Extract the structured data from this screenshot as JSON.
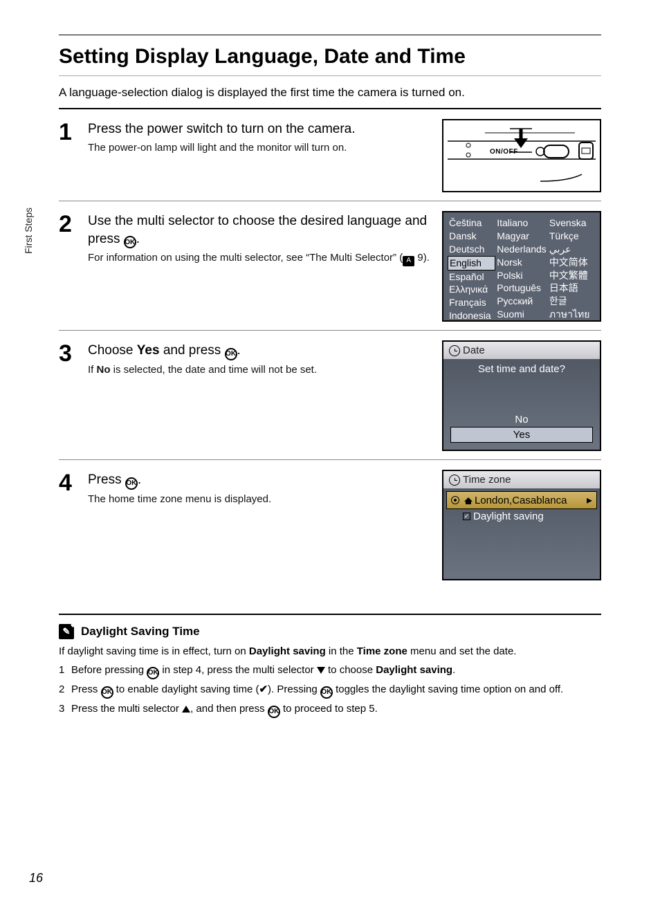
{
  "side_tab": "First Steps",
  "title": "Setting Display Language, Date and Time",
  "intro": "A language-selection dialog is displayed the first time the camera is turned on.",
  "ok_glyph": "OK",
  "steps": {
    "s1": {
      "num": "1",
      "head": "Press the power switch to turn on the camera.",
      "desc": "The power-on lamp will light and the monitor will turn on.",
      "onoff": "ON/OFF"
    },
    "s2": {
      "num": "2",
      "head_a": "Use the multi selector to choose the desired language and press ",
      "head_b": ".",
      "desc_a": "For information on using the multi selector, see “The Multi Selector” (",
      "desc_b": " 9).",
      "langs": {
        "c1": [
          "Čeština",
          "Dansk",
          "Deutsch",
          "English",
          "Español",
          "Ελληνικά",
          "Français",
          "Indonesia"
        ],
        "c2": [
          "Italiano",
          "Magyar",
          "Nederlands",
          "Norsk",
          "Polski",
          "Português",
          "Русский",
          "Suomi"
        ],
        "c3": [
          "Svenska",
          "Türkçe",
          "عربي",
          "中文简体",
          "中文繁體",
          "日本語",
          "한글",
          "ภาษาไทย"
        ]
      }
    },
    "s3": {
      "num": "3",
      "head_a": "Choose ",
      "head_yes": "Yes",
      "head_b": " and press ",
      "head_c": ".",
      "desc_a": "If ",
      "desc_no": "No",
      "desc_b": " is selected, the date and time will not be set.",
      "screen": {
        "header": "Date",
        "prompt": "Set time and date?",
        "opt_no": "No",
        "opt_yes": "Yes"
      }
    },
    "s4": {
      "num": "4",
      "head_a": "Press ",
      "head_b": ".",
      "desc": "The home time zone menu is displayed.",
      "screen": {
        "header": "Time zone",
        "location": "London,Casablanca",
        "dst": "Daylight saving"
      }
    }
  },
  "note": {
    "title": "Daylight Saving Time",
    "intro_a": "If daylight saving time is in effect, turn on ",
    "intro_b": "Daylight saving",
    "intro_c": " in the ",
    "intro_d": "Time zone",
    "intro_e": " menu and set the date.",
    "li1_a": "Before pressing ",
    "li1_b": " in step 4, press the multi selector ",
    "li1_c": " to choose ",
    "li1_d": "Daylight saving",
    "li1_e": ".",
    "li2_a": "Press ",
    "li2_b": " to enable daylight saving time (",
    "li2_c": "). Pressing ",
    "li2_d": " toggles the daylight saving time option on and off.",
    "li3_a": "Press the multi selector ",
    "li3_b": ", and then press ",
    "li3_c": " to proceed to step 5.",
    "nums": [
      "1",
      "2",
      "3"
    ],
    "check": "✔"
  },
  "page_number": "16"
}
